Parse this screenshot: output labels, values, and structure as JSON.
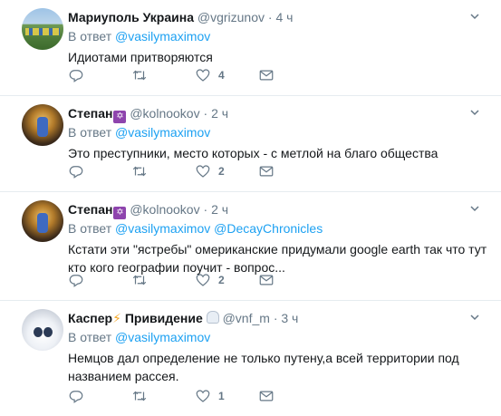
{
  "tweets": [
    {
      "name": "Мариуполь Украина",
      "handle": "@vgrizunov",
      "time": "4 ч",
      "reply_prefix": "В ответ",
      "reply_to": "@vasilymaximov",
      "reply_to_2": "",
      "text": "Идиотами притворяются",
      "likes": "4",
      "badge": ""
    },
    {
      "name": "Степан",
      "handle": "@kolnookov",
      "time": "2 ч",
      "reply_prefix": "В ответ",
      "reply_to": "@vasilymaximov",
      "reply_to_2": "",
      "text": "Это преступники, место которых - с метлой на благо общества",
      "likes": "2",
      "badge": "✡"
    },
    {
      "name": "Степан",
      "handle": "@kolnookov",
      "time": "2 ч",
      "reply_prefix": "В ответ",
      "reply_to": "@vasilymaximov",
      "reply_to_2": "@DecayChronicles",
      "text": "Кстати эти \"ястребы\" омериканские придумали google earth так что тут кто кого географии поучит - вопрос...",
      "likes": "2",
      "badge": "✡"
    },
    {
      "name_part1": "Каспер",
      "name_emoji": "⚡",
      "name_part2": "Привидение",
      "handle": "@vnf_m",
      "time": "3 ч",
      "reply_prefix": "В ответ",
      "reply_to": "@vasilymaximov",
      "reply_to_2": "",
      "text": "Немцов дал определение не только путену,а всей территории под названием рассея.",
      "likes": "1"
    }
  ],
  "separator": "·",
  "colors": {
    "accent": "#1da1f2",
    "muted": "#657786",
    "text": "#14171a",
    "border": "#e6ecf0"
  },
  "icons": [
    "reply-icon",
    "retweet-icon",
    "like-icon",
    "message-icon",
    "chevron-down-icon"
  ]
}
